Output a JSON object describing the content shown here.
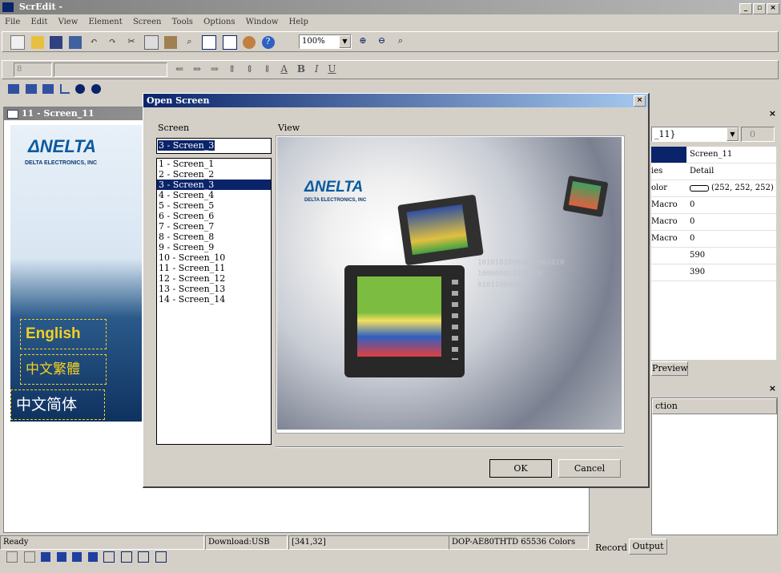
{
  "app": {
    "title": "ScrEdit -"
  },
  "menu": [
    "File",
    "Edit",
    "View",
    "Element",
    "Screen",
    "Tools",
    "Options",
    "Window",
    "Help"
  ],
  "toolbar": {
    "zoom": "100%",
    "font_size": "8"
  },
  "screen_window": {
    "title": "11 - Screen_11",
    "logo_text": "ΔNELTA",
    "logo_sub": "DELTA ELECTRONICS, INC",
    "lang_buttons": [
      "English",
      "中文繁體",
      "中文简体"
    ]
  },
  "dialog": {
    "title": "Open Screen",
    "screen_label": "Screen",
    "view_label": "View",
    "selected_screen": "3 - Screen_3",
    "screens": [
      "1 - Screen_1",
      "2 - Screen_2",
      "3 - Screen_3",
      "4 - Screen_4",
      "5 - Screen_5",
      "6 - Screen_6",
      "7 - Screen_7",
      "8 - Screen_8",
      "9 - Screen_9",
      "10 - Screen_10",
      "11 - Screen_11",
      "12 - Screen_12",
      "13 - Screen_13",
      "14 - Screen_14"
    ],
    "selected_index": 2,
    "preview_logo": "ΔNELTA",
    "preview_sub": "DELTA ELECTRONICS, INC",
    "ok": "OK",
    "cancel": "Cancel"
  },
  "properties": {
    "combo": "_11}",
    "spin": "0",
    "rows": [
      {
        "name": "",
        "value": "Screen_11"
      },
      {
        "name": "ies",
        "value": "Detail"
      },
      {
        "name": "olor",
        "value": "(252, 252, 252)"
      },
      {
        "name": "Macro",
        "value": "0"
      },
      {
        "name": "Macro",
        "value": "0"
      },
      {
        "name": "Macro",
        "value": "0"
      },
      {
        "name": "",
        "value": "590"
      },
      {
        "name": "",
        "value": "390"
      }
    ],
    "tab": "Preview"
  },
  "output_panel": {
    "column": "ction",
    "tabs": [
      "Record",
      "Output"
    ]
  },
  "status": {
    "ready": "Ready",
    "download": "Download:USB",
    "coords": "[341,32]",
    "model": "DOP-AE80THTD 65536 Colors"
  },
  "colors": {
    "title_active": "#0a246a",
    "selection": "#0a246a",
    "lang_yellow": "#f5d020",
    "panel_bg": "#d4d0c8"
  }
}
